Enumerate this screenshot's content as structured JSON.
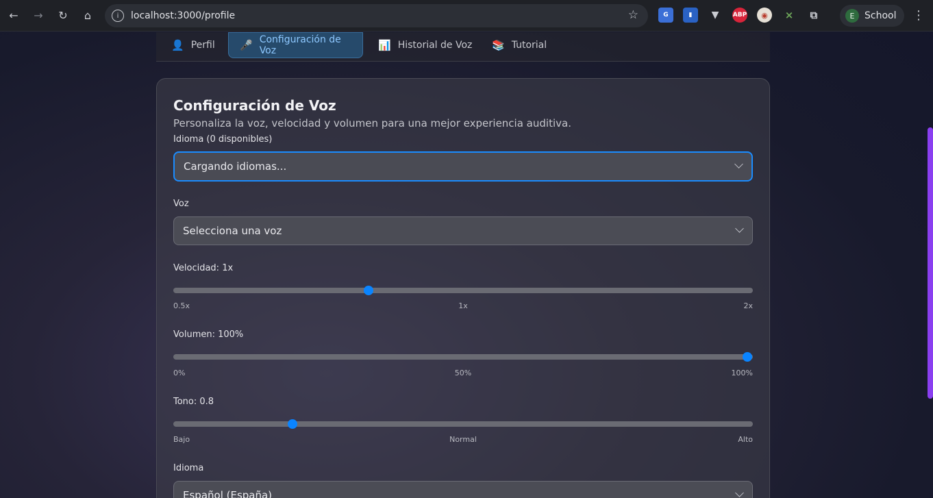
{
  "browser": {
    "url": "localhost:3000/profile",
    "profile_initial": "E",
    "profile_name": "School",
    "extensions": [
      "translate-icon",
      "bookmark-icon",
      "vee-icon",
      "ABP",
      "mask-icon",
      "puzzle-x-icon",
      "extensions-icon"
    ]
  },
  "tabs": [
    {
      "icon": "👤",
      "label": "Perfil"
    },
    {
      "icon": "🎤",
      "label": "Configuración de Voz"
    },
    {
      "icon": "📊",
      "label": "Historial de Voz"
    },
    {
      "icon": "📚",
      "label": "Tutorial"
    }
  ],
  "card": {
    "title": "Configuración de Voz",
    "subtitle": "Personaliza la voz, velocidad y volumen para una mejor experiencia auditiva.",
    "language_label": "Idioma (0 disponibles)",
    "language_value": "Cargando idiomas...",
    "voice_label": "Voz",
    "voice_value": "Selecciona una voz",
    "speed": {
      "label": "Velocidad: 1x",
      "value": 1,
      "min": 0.5,
      "max": 2,
      "ticks": [
        "0.5x",
        "1x",
        "2x"
      ]
    },
    "volume": {
      "label": "Volumen: 100%",
      "value": 100,
      "min": 0,
      "max": 100,
      "ticks": [
        "0%",
        "50%",
        "100%"
      ]
    },
    "pitch": {
      "label": "Tono: 0.8",
      "value": 0.8,
      "ticks": [
        "Bajo",
        "Normal",
        "Alto"
      ]
    },
    "idioma_label": "Idioma",
    "idioma_value": "Español (España)"
  },
  "colors": {
    "accent": "#0a84ff",
    "scrollbar": "#8a3ff0"
  }
}
